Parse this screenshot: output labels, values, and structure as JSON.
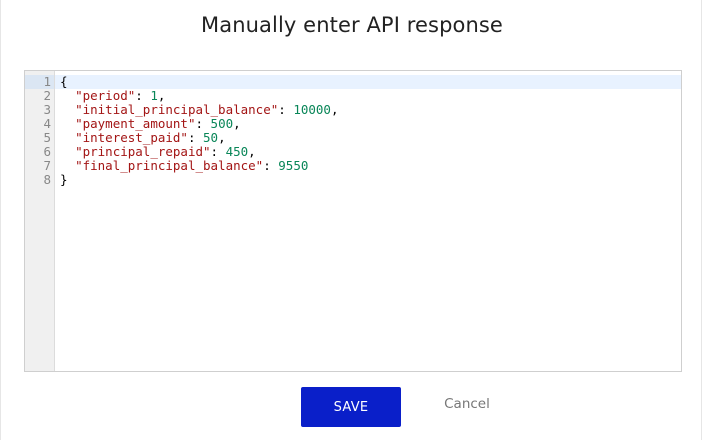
{
  "dialog": {
    "title": "Manually enter API response"
  },
  "editor": {
    "line_numbers": [
      "1",
      "2",
      "3",
      "4",
      "5",
      "6",
      "7",
      "8"
    ],
    "lines": [
      [
        {
          "t": "punct",
          "v": "{"
        }
      ],
      [
        {
          "t": "punct",
          "v": "  "
        },
        {
          "t": "key",
          "v": "\"period\""
        },
        {
          "t": "punct",
          "v": ": "
        },
        {
          "t": "num",
          "v": "1"
        },
        {
          "t": "punct",
          "v": ","
        }
      ],
      [
        {
          "t": "punct",
          "v": "  "
        },
        {
          "t": "key",
          "v": "\"initial_principal_balance\""
        },
        {
          "t": "punct",
          "v": ": "
        },
        {
          "t": "num",
          "v": "10000"
        },
        {
          "t": "punct",
          "v": ","
        }
      ],
      [
        {
          "t": "punct",
          "v": "  "
        },
        {
          "t": "key",
          "v": "\"payment_amount\""
        },
        {
          "t": "punct",
          "v": ": "
        },
        {
          "t": "num",
          "v": "500"
        },
        {
          "t": "punct",
          "v": ","
        }
      ],
      [
        {
          "t": "punct",
          "v": "  "
        },
        {
          "t": "key",
          "v": "\"interest_paid\""
        },
        {
          "t": "punct",
          "v": ": "
        },
        {
          "t": "num",
          "v": "50"
        },
        {
          "t": "punct",
          "v": ","
        }
      ],
      [
        {
          "t": "punct",
          "v": "  "
        },
        {
          "t": "key",
          "v": "\"principal_repaid\""
        },
        {
          "t": "punct",
          "v": ": "
        },
        {
          "t": "num",
          "v": "450"
        },
        {
          "t": "punct",
          "v": ","
        }
      ],
      [
        {
          "t": "punct",
          "v": "  "
        },
        {
          "t": "key",
          "v": "\"final_principal_balance\""
        },
        {
          "t": "punct",
          "v": ": "
        },
        {
          "t": "num",
          "v": "9550"
        }
      ],
      [
        {
          "t": "punct",
          "v": "}"
        }
      ]
    ]
  },
  "actions": {
    "save_label": "SAVE",
    "cancel_label": "Cancel"
  },
  "colors": {
    "save_button": "#0a1fc9",
    "json_key": "#a31515",
    "json_number": "#098658",
    "active_line": "#e8f2ff"
  }
}
